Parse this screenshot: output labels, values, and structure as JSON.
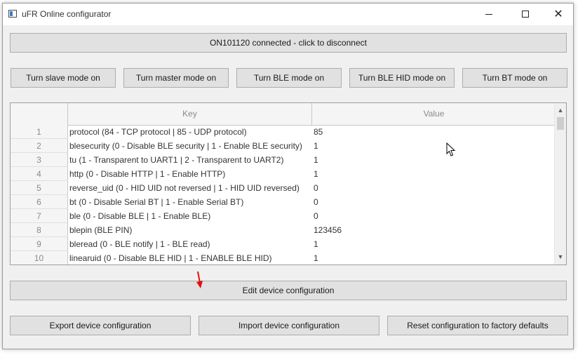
{
  "window": {
    "title": "uFR Online configurator"
  },
  "icons": {
    "app": "app-window-icon",
    "minimize": "minimize-icon",
    "maximize": "maximize-icon",
    "close": "close-icon",
    "close_glyph": "✕",
    "scroll_up_glyph": "▲",
    "scroll_down_glyph": "▼"
  },
  "connection": {
    "label": "ON101120 connected - click to disconnect"
  },
  "mode_buttons": [
    {
      "label": "Turn slave mode on"
    },
    {
      "label": "Turn master mode on"
    },
    {
      "label": "Turn BLE mode on"
    },
    {
      "label": "Turn BLE HID mode on"
    },
    {
      "label": "Turn BT mode on"
    }
  ],
  "table": {
    "headers": {
      "key": "Key",
      "value": "Value"
    },
    "rows": [
      {
        "num": "1",
        "key": "protocol (84 - TCP protocol | 85 - UDP protocol)",
        "value": "85"
      },
      {
        "num": "2",
        "key": "blesecurity (0 - Disable BLE security | 1 - Enable BLE security)",
        "value": "1"
      },
      {
        "num": "3",
        "key": "tu (1 - Transparent to UART1 | 2 - Transparent to UART2)",
        "value": "1"
      },
      {
        "num": "4",
        "key": "http (0 - Disable HTTP | 1 - Enable HTTP)",
        "value": "1"
      },
      {
        "num": "5",
        "key": "reverse_uid (0 - HID UID not reversed | 1 - HID UID reversed)",
        "value": "0"
      },
      {
        "num": "6",
        "key": "bt (0 - Disable Serial BT | 1 - Enable Serial BT)",
        "value": "0"
      },
      {
        "num": "7",
        "key": "ble (0 - Disable BLE | 1 - Enable BLE)",
        "value": "0"
      },
      {
        "num": "8",
        "key": "blepin (BLE PIN)",
        "value": "123456"
      },
      {
        "num": "9",
        "key": "bleread (0 - BLE notify | 1 - BLE read)",
        "value": "1"
      },
      {
        "num": "10",
        "key": "linearuid (0 - Disable BLE HID | 1 - ENABLE BLE HID)",
        "value": "1"
      }
    ]
  },
  "edit_button": {
    "label": "Edit device configuration"
  },
  "bottom_buttons": [
    {
      "label": "Export device configuration"
    },
    {
      "label": "Import device configuration"
    },
    {
      "label": "Reset configuration to factory defaults"
    }
  ],
  "colors": {
    "window_bg": "#f0f0f0",
    "button_bg": "#e1e1e1",
    "button_border": "#adadad",
    "annotation_arrow": "#e01010"
  }
}
